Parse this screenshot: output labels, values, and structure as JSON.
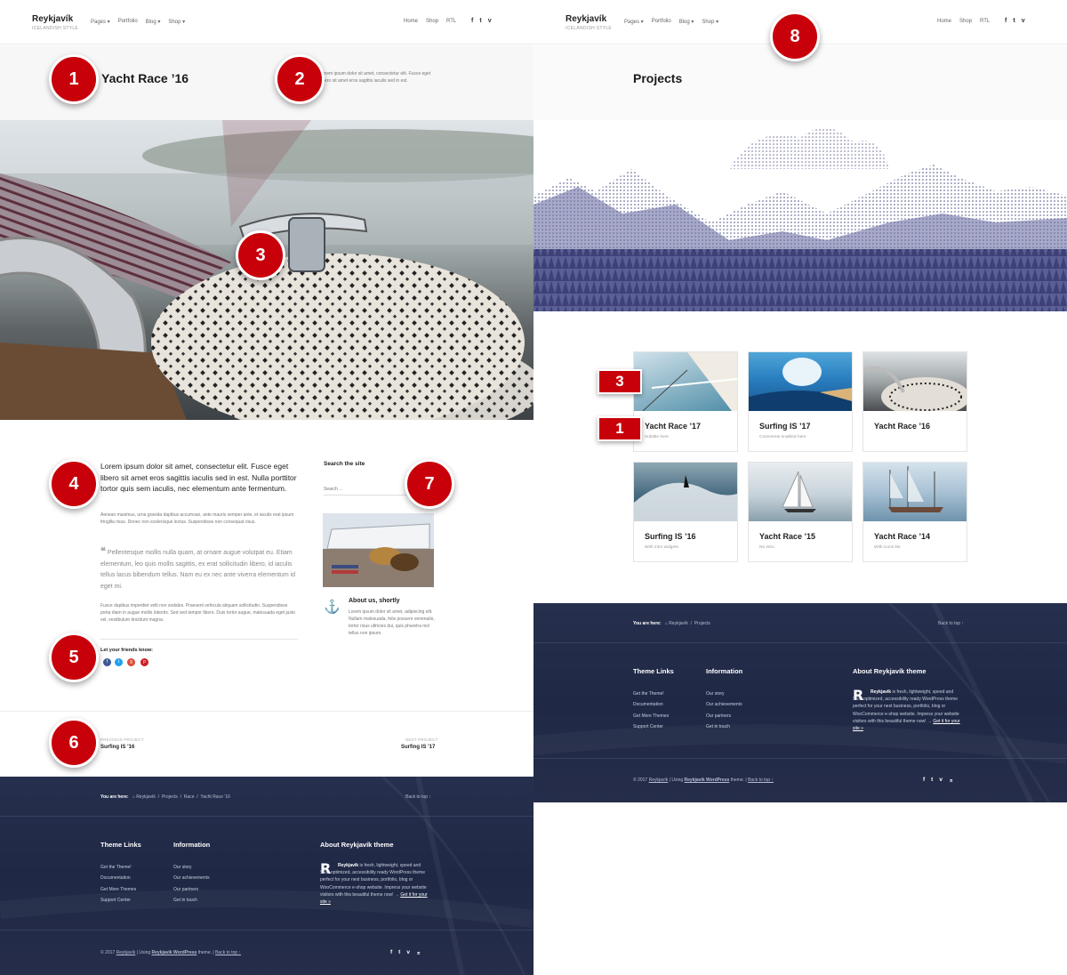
{
  "site": {
    "name": "Reykjavík",
    "tagline": "ICELANDISH STYLE"
  },
  "nav": {
    "pages": "Pages",
    "portfolio": "Portfolio",
    "blog": "Blog",
    "shop": "Shop",
    "home": "Home",
    "shop2": "Shop",
    "rtl": "RTL"
  },
  "social": {
    "facebook": "f",
    "twitter": "t",
    "vimeo": "v"
  },
  "left": {
    "title": "Yacht Race ’16",
    "description": "Lorem ipsum dolor sit amet, consectetur elit. Fusce eget libero sit amet eros sagittis iaculis sed in est.",
    "lead": "Lorem ipsum dolor sit amet, consectetur elit. Fusce eget libero sit amet eros sagittis iaculis sed in est. Nulla porttitor tortor quis sem iaculis, nec elementum ante fermentum.",
    "para1": "Aenean maximus, urna gravida dapibus accumsan, ante mauris semper ante, et iaculis erat ipsum fringilla risus. Donec non scelerisque lectus. Suspendisse non consequat risus.",
    "quote": "Pellentesque mollis nulla quam, at ornare augue volutpat eu. Etiam elementum, leo quis mollis sagittis, ex erat sollicitudin libero, id iaculis tellus lacus bibendum tellus. Nam eu ex nec ante viverra elementum id eget mi.",
    "para2": "Fusce dapibus imperdiet velit non sodales. Praesent vehicula aliquam sollicitudin. Suspendisse porta diam in augue mollis lobortis. Sed sed tempor libero. Duis tortor augue, malesuada eget justo vel, vestibulum tincidunt magna.",
    "share_label": "Let your friends know:",
    "search_title": "Search the site",
    "search_placeholder": "Search ...",
    "about_title": "About us, shortly",
    "about_text": "Lorem ipsum dolor sit amet, adipiscing elit. Nullam malesuada, felis posuere venenatis, tortor risus ultricies dui, quis pharetra nisl tellus non ipsum.",
    "prev_label": "PREVIOUS PROJECT",
    "prev_value": "Surfing IS ’16",
    "next_label": "NEXT PROJECT",
    "next_value": "Surfing IS ’17",
    "breadcrumb": {
      "label": "You are here:",
      "items": [
        "Reykjavík",
        "Projects",
        "Race",
        "Yacht Race ’16"
      ]
    }
  },
  "right": {
    "title": "Projects",
    "breadcrumb": {
      "label": "You are here:",
      "items": [
        "Reykjavík",
        "Projects"
      ]
    },
    "cards": [
      {
        "title": "Yacht Race ’17",
        "subtitle": "Subtitle here"
      },
      {
        "title": "Surfing IS ’17",
        "subtitle": "Comments enabled here"
      },
      {
        "title": "Yacht Race ’16",
        "subtitle": ""
      },
      {
        "title": "Surfing IS ’16",
        "subtitle": "With intro widgets"
      },
      {
        "title": "Yacht Race ’15",
        "subtitle": "No intro"
      },
      {
        "title": "Yacht Race ’14",
        "subtitle": "With icons list"
      }
    ]
  },
  "footer": {
    "back_to_top": "Back to top ↑",
    "theme_links_title": "Theme Links",
    "theme_links": [
      "Get the Theme!",
      "Documentation",
      "Get More Themes",
      "Support Center"
    ],
    "info_title": "Information",
    "info_links": [
      "Our story",
      "Our achievements",
      "Our partners",
      "Get in touch"
    ],
    "about_title": "About Reykjavík theme",
    "about_name": "Reykjavík",
    "about_text": " is fresh, lightweight, speed and SEO optimized, accessibility ready WordPress theme perfect for your next business, portfolio, blog or WooCommerce e-shop website. Impress your website visitors with this beautiful theme now! → ",
    "about_link": "Get it for your site »",
    "copyright_prefix": "© 2017 ",
    "copyright_site": "Reykjavík",
    "copyright_mid": " | Using ",
    "copyright_theme": "Reykjavík WordPress",
    "copyright_end": " theme. | ",
    "copyright_top": "Back to top ↑"
  },
  "badges": {
    "b1": "1",
    "b2": "2",
    "b3": "3",
    "b4": "4",
    "b5": "5",
    "b6": "6",
    "b7": "7",
    "b8": "8",
    "sq3": "3",
    "sq1": "1"
  },
  "colors": {
    "badge_red": "#c8000a",
    "footer_navy": "#222b48",
    "mountain_ink": "#4b4f86"
  },
  "icons": {
    "anchor": "anchor-icon",
    "home": "home-icon",
    "quote": "quote-icon"
  }
}
